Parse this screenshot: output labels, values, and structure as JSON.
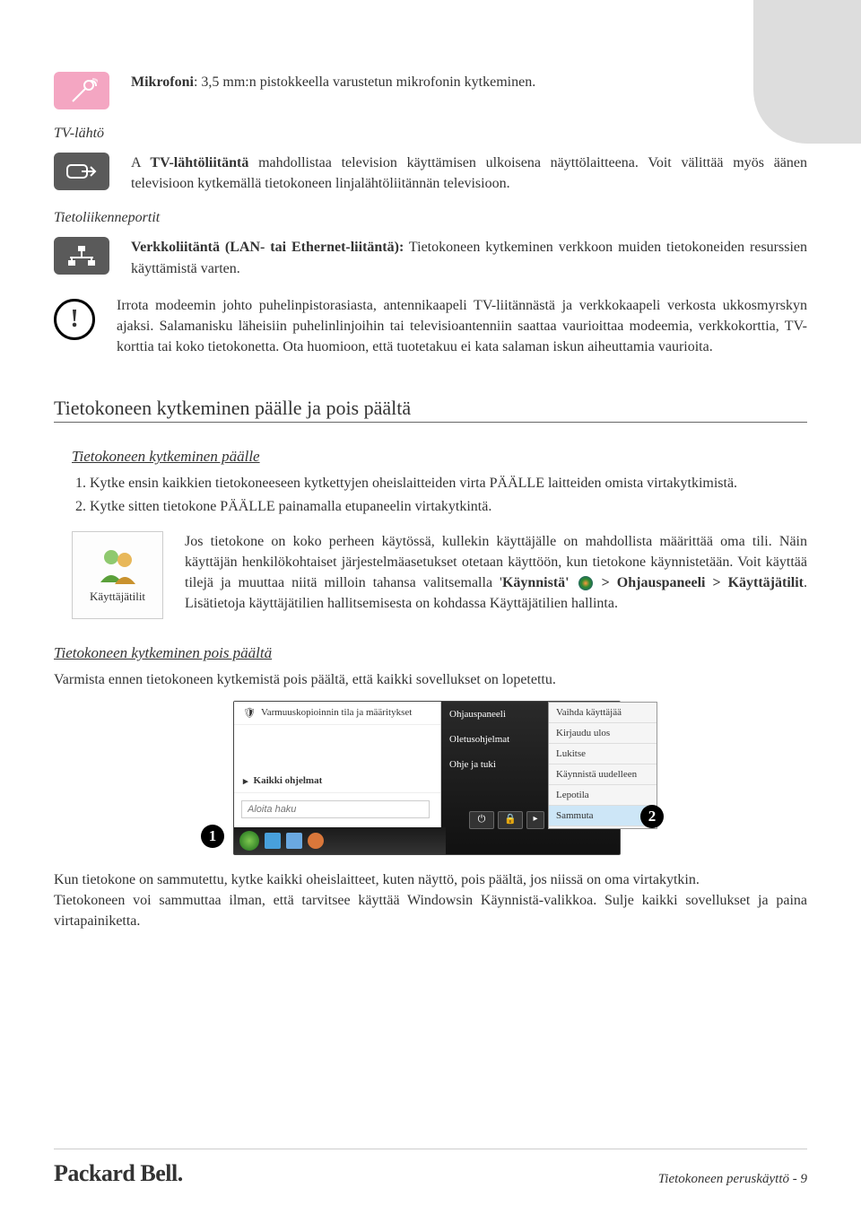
{
  "mic": {
    "label": "Mikrofoni",
    "text": ": 3,5 mm:n pistokkeella varustetun mikrofonin kytkeminen."
  },
  "tv": {
    "heading": "TV-lähtö",
    "text_before": "A ",
    "label": "TV-lähtöliitäntä",
    "text_after": " mahdollistaa television käyttämisen ulkoisena näyttölaitteena. Voit välittää myös äänen televisioon kytkemällä tietokoneen linjalähtöliitännän televisioon."
  },
  "net": {
    "heading": "Tietoliikenneportit",
    "label": "Verkkoliitäntä (LAN- tai Ethernet-liitäntä):",
    "text": " Tietokoneen kytkeminen verkkoon muiden tietokoneiden resurssien käyttämistä varten."
  },
  "warn": "Irrota modeemin johto puhelinpistorasiasta, antennikaapeli TV-liitännästä ja verkkokaapeli verkosta ukkosmyrskyn ajaksi. Salamanisku läheisiin puhelinlinjoihin tai televisioantenniin saattaa vaurioittaa modeemia, verkkokorttia, TV-korttia tai koko tietokonetta. Ota huomioon, että tuotetakuu ei kata salaman iskun aiheuttamia vaurioita.",
  "h2": "Tietokoneen kytkeminen päälle ja pois päältä",
  "on": {
    "heading": "Tietokoneen kytkeminen päälle",
    "li1": "Kytke ensin kaikkien tietokoneeseen kytkettyjen oheislaitteiden virta PÄÄLLE laitteiden omista virtakytkimistä.",
    "li2": "Kytke sitten tietokone PÄÄLLE painamalla etupaneelin virtakytkintä."
  },
  "users": {
    "box_label": "Käyttäjätilit",
    "p1": "Jos tietokone on koko perheen käytössä, kullekin käyttäjälle on mahdollista määrittää oma tili. Näin käyttäjän henkilökohtaiset järjestelmäasetukset otetaan käyttöön, kun tietokone käynnistetään. Voit käyttää tilejä ja muuttaa niitä milloin tahansa valitsemalla '",
    "bold1": "Käynnistä'",
    "path": " > Ohjauspaneeli > Käyttäjätilit",
    "p2": ". Lisätietoja käyttäjätilien hallitsemisesta on kohdassa Käyttäjätilien hallinta."
  },
  "off": {
    "heading": "Tietokoneen kytkeminen pois päältä",
    "intro": "Varmista ennen tietokoneen kytkemistä pois päältä, että kaikki sovellukset on lopetettu.",
    "p1": "Kun tietokone on sammutettu, kytke kaikki oheislaitteet, kuten näyttö, pois päältä, jos niissä on oma virtakytkin.",
    "p2": "Tietokoneen voi sammuttaa ilman, että tarvitsee käyttää Windowsin Käynnistä-valikkoa. Sulje kaikki sovellukset ja paina virtapainiketta."
  },
  "startmenu": {
    "backup": "Varmuuskopioinnin tila ja määritykset",
    "allprograms": "Kaikki ohjelmat",
    "search": "Aloita haku",
    "mid1": "Ohjauspaneeli",
    "mid2": "Oletusohjelmat",
    "mid3": "Ohje ja tuki",
    "r1": "Vaihda käyttäjää",
    "r2": "Kirjaudu ulos",
    "r3": "Lukitse",
    "r4": "Käynnistä uudelleen",
    "r5": "Lepotila",
    "r6": "Sammuta"
  },
  "badges": {
    "b1": "1",
    "b2": "2"
  },
  "footer": {
    "brand": "Packard Bell.",
    "page": "Tietokoneen peruskäyttö -  9"
  }
}
